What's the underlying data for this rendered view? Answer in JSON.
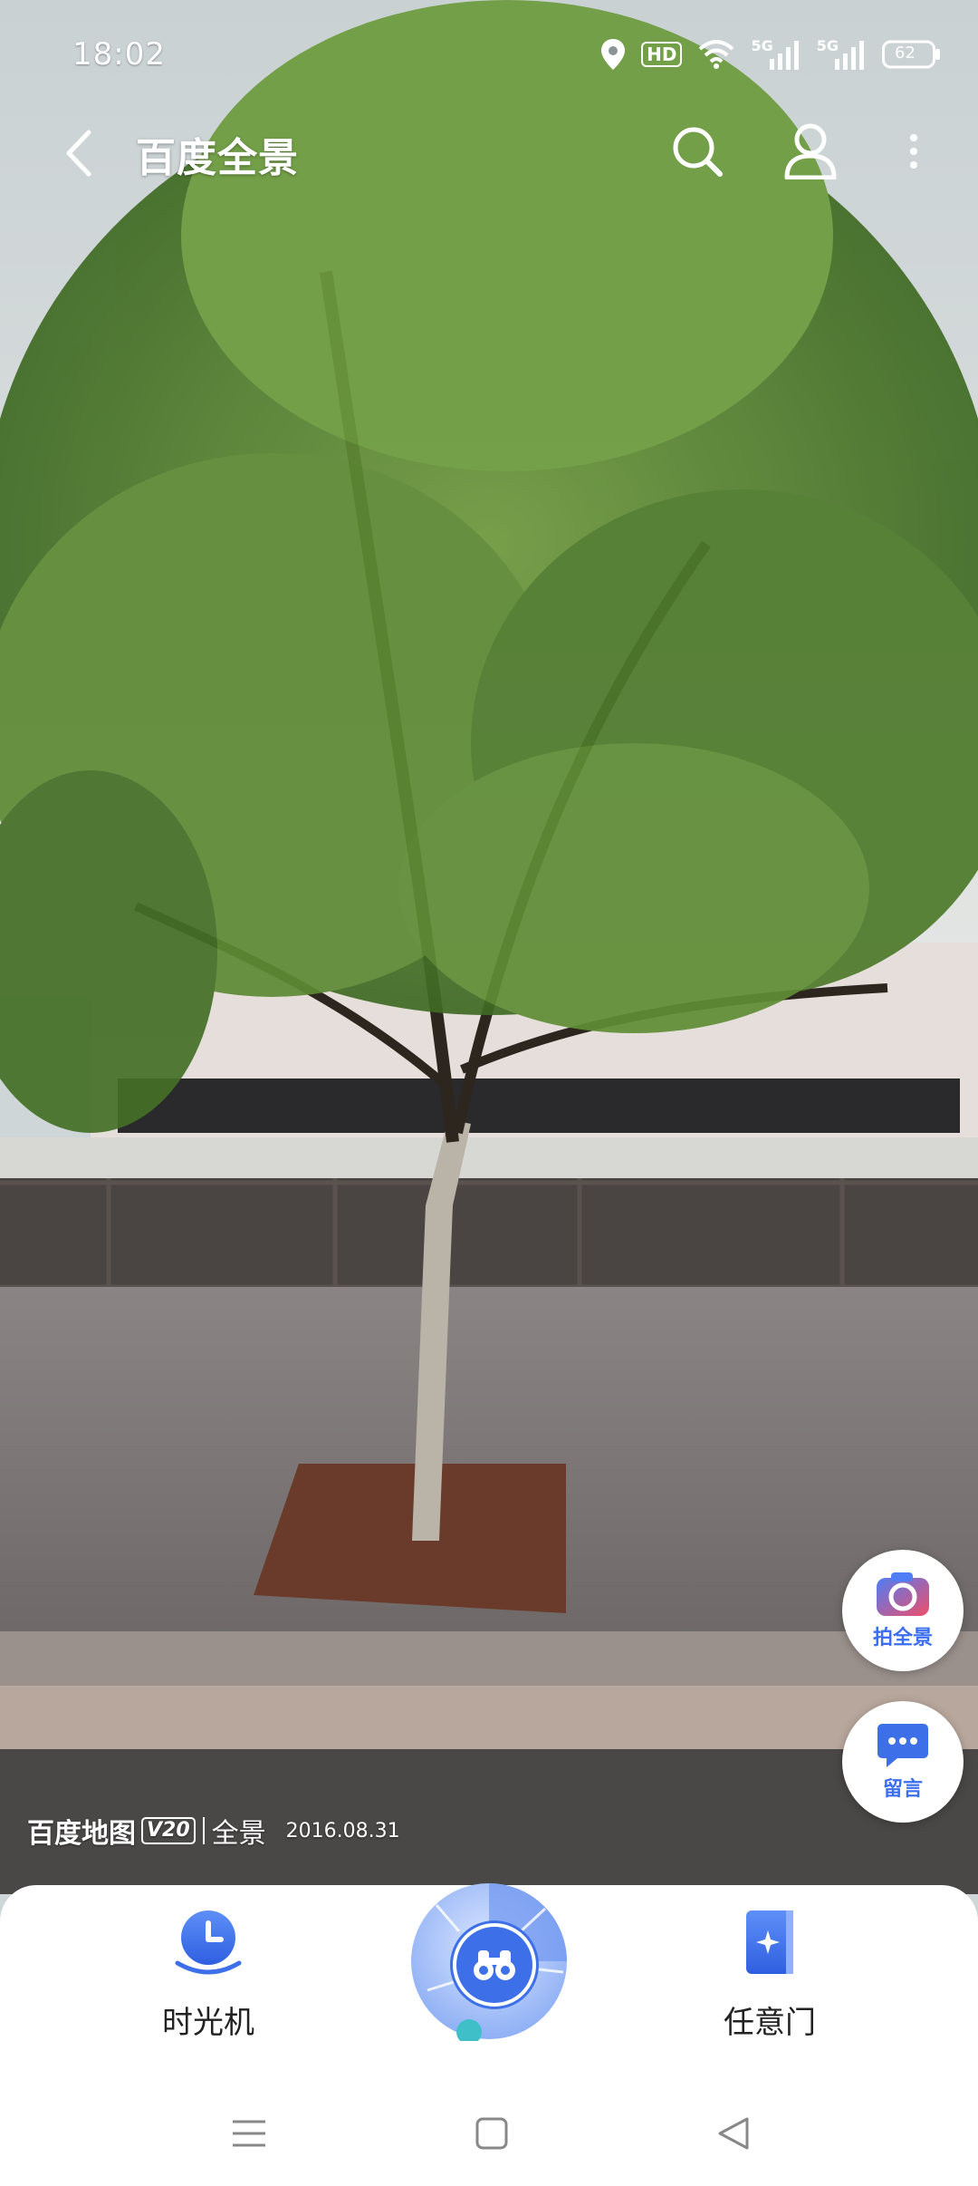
{
  "status_bar": {
    "time": "18:02",
    "hd_badge": "HD",
    "net1": "5G",
    "net2": "5G",
    "battery": "62"
  },
  "header": {
    "title": "百度全景"
  },
  "fabs": {
    "photo_label": "拍全景",
    "comment_label": "留言"
  },
  "watermark": {
    "brand": "百度地图",
    "version": "V20",
    "product": "全景",
    "date": "2016.08.31"
  },
  "dock": {
    "time_machine_label": "时光机",
    "portal_label": "任意门"
  },
  "colors": {
    "accent": "#3c6fe8",
    "fab_text": "#3b6ef0"
  }
}
